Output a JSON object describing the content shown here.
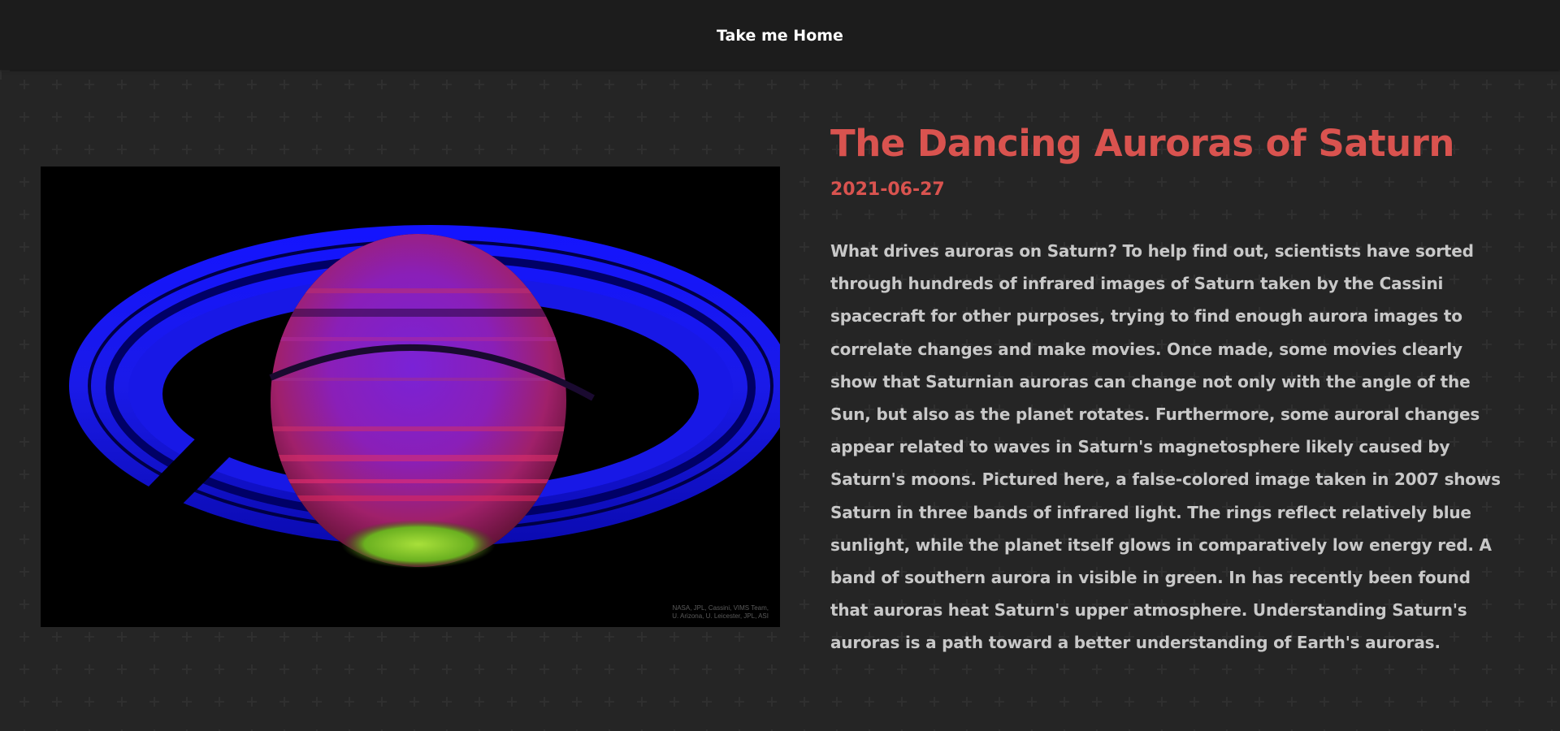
{
  "nav": {
    "home_label": "Take me Home"
  },
  "apod": {
    "title": "The Dancing Auroras of Saturn",
    "date": "2021-06-27",
    "explanation": "What drives auroras on Saturn? To help find out, scientists have sorted through hundreds of infrared images of Saturn taken by the Cassini spacecraft for other purposes, trying to find enough aurora images to correlate changes and make movies. Once made, some movies clearly show that Saturnian auroras can change not only with the angle of the Sun, but also as the planet rotates. Furthermore, some auroral changes appear related to waves in Saturn's magnetosphere likely caused by Saturn's moons. Pictured here, a false-colored image taken in 2007 shows Saturn in three bands of infrared light. The rings reflect relatively blue sunlight, while the planet itself glows in comparatively low energy red. A band of southern aurora in visible in green. In has recently been found that auroras heat Saturn's upper atmosphere. Understanding Saturn's auroras is a path toward a better understanding of Earth's auroras.",
    "image_credit_line1": "NASA, JPL, Cassini, VIMS Team,",
    "image_credit_line2": "U. Arizona, U. Leicester, JPL, ASI"
  },
  "colors": {
    "accent": "#d9534f",
    "background": "#252525",
    "topbar": "#1c1c1c",
    "body_text": "#c8c8c8"
  }
}
